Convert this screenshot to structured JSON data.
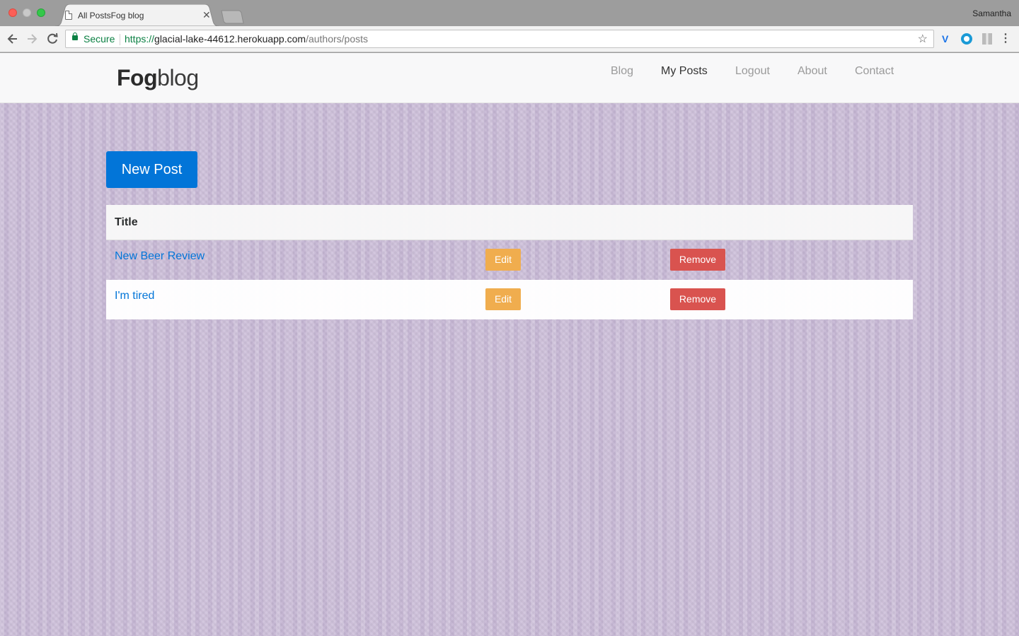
{
  "browser": {
    "tab_title": "All PostsFog blog",
    "tab_close": "✕",
    "profile_name": "Samantha",
    "secure_label": "Secure",
    "url_scheme": "https://",
    "url_host": "glacial-lake-44612.herokuapp.com",
    "url_path": "/authors/posts",
    "icons": [
      "back-arrow-icon",
      "forward-arrow-icon",
      "reload-icon",
      "lock-icon",
      "star-icon",
      "extension-icon",
      "menu-dots-icon"
    ]
  },
  "site": {
    "brand_bold": "Fog",
    "brand_light": "blog",
    "nav": [
      {
        "label": "Blog",
        "active": false
      },
      {
        "label": "My Posts",
        "active": true
      },
      {
        "label": "Logout",
        "active": false
      },
      {
        "label": "About",
        "active": false
      },
      {
        "label": "Contact",
        "active": false
      }
    ]
  },
  "main": {
    "new_post_label": "New Post",
    "table": {
      "header_title": "Title",
      "rows": [
        {
          "title": "New Beer Review",
          "edit_label": "Edit",
          "remove_label": "Remove"
        },
        {
          "title": "I'm tired",
          "edit_label": "Edit",
          "remove_label": "Remove"
        }
      ]
    }
  },
  "colors": {
    "primary": "#0275d8",
    "warning": "#f0ad4e",
    "danger": "#d9534f",
    "background": "#cbbdd8"
  }
}
